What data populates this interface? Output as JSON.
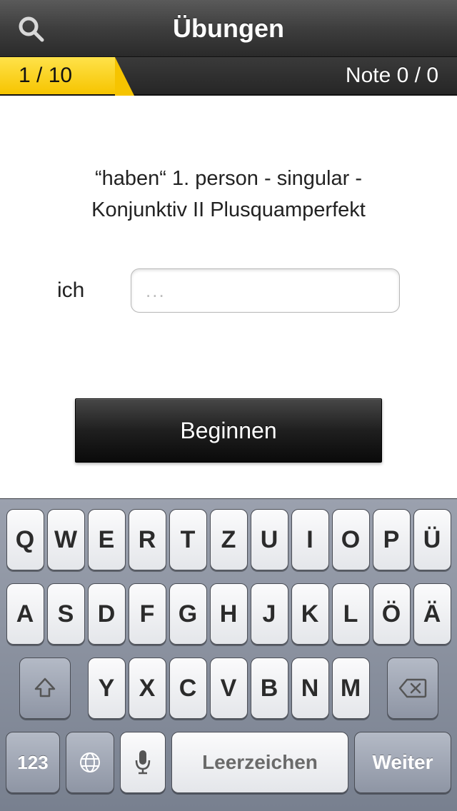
{
  "header": {
    "title": "Übungen"
  },
  "progress": {
    "counter": "1 / 10",
    "score_label": "Note 0 / 0"
  },
  "exercise": {
    "prompt_line1": "“haben“  1. person - singular -",
    "prompt_line2": "Konjunktiv II Plusquamperfekt",
    "pronoun": "ich",
    "answer_placeholder": "..."
  },
  "actions": {
    "begin": "Beginnen"
  },
  "keyboard": {
    "row1": [
      "Q",
      "W",
      "E",
      "R",
      "T",
      "Z",
      "U",
      "I",
      "O",
      "P",
      "Ü"
    ],
    "row2": [
      "A",
      "S",
      "D",
      "F",
      "G",
      "H",
      "J",
      "K",
      "L",
      "Ö",
      "Ä"
    ],
    "row3": [
      "Y",
      "X",
      "C",
      "V",
      "B",
      "N",
      "M"
    ],
    "numbers_key": "123",
    "space_label": "Leerzeichen",
    "return_label": "Weiter"
  }
}
